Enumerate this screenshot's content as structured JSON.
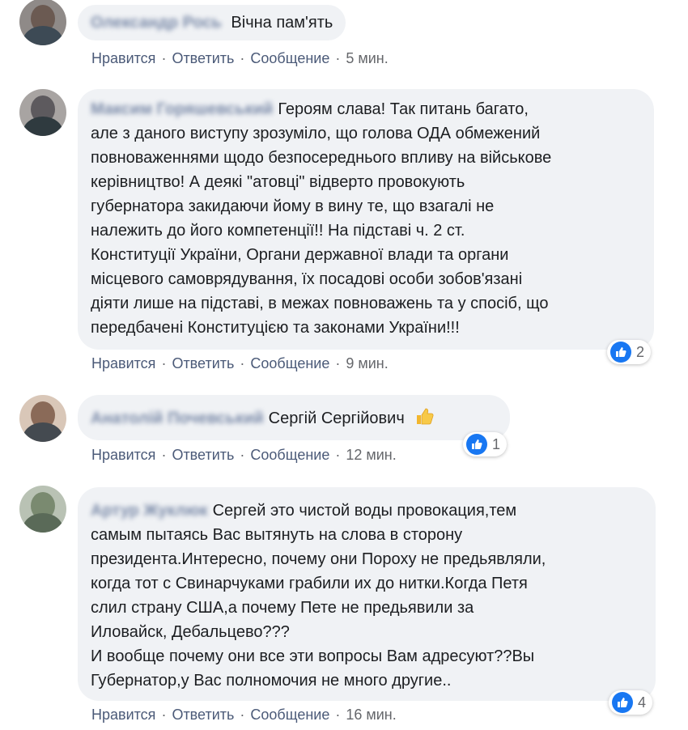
{
  "comments": [
    {
      "author": "Олександр Рось",
      "text": "Вічна пам'ять",
      "actions": {
        "like": "Нравится",
        "reply": "Ответить",
        "message": "Сообщение",
        "time": "5 мин."
      },
      "avatar_colors": [
        "#6b5a52",
        "#3d4a55"
      ]
    },
    {
      "author": "Максим Горяшевський",
      "text": "Героям слава! Так питань багато,\nале з даного виступу зрозуміло, що голова ОДА обмежений\nповноваженнями щодо безпосереднього впливу на військове\nкерівництво! А деякі \"атовці\" відверто провокують\nгубернатора закидаючи йому в вину те, що взагалі не\nналежить до його компетенції!! На підставі ч. 2 ст.\nКонституції України, Органи державної влади та органи\nмісцевого самоврядування, їх посадові особи зобов'язані\nдіяти лише на підставі, в межах повноважень та у спосіб, що\nпередбачені Конституцією та законами України!!!",
      "actions": {
        "like": "Нравится",
        "reply": "Ответить",
        "message": "Сообщение",
        "time": "9 мин."
      },
      "reaction_count": "2",
      "avatar_colors": [
        "#5d5a5e",
        "#2f3a3f"
      ]
    },
    {
      "author": "Анатолій Почевський",
      "text": "Сергій Сергійович",
      "emoji": "thumbs-up-emoji",
      "actions": {
        "like": "Нравится",
        "reply": "Ответить",
        "message": "Сообщение",
        "time": "12 мин."
      },
      "reaction_count": "1",
      "avatar_colors": [
        "#8a6a58",
        "#444a50"
      ]
    },
    {
      "author": "Артур Жуклюк",
      "text": "Сергей это чистой воды провокация,тем\nсамым пытаясь Вас вытянуть на слова в сторону\nпрезидента.Интересно, почему они Пороху не предьявляли,\nкогда тот с Свинарчуками грабили их до нитки.Когда Петя\nслил страну США,а почему Пете не предьявили за\nИловайск, Дебальцево???\nИ вообще почему они все эти вопросы Вам адресуют??Вы\nГубернатор,у Вас полномочия не много другие..",
      "actions": {
        "like": "Нравится",
        "reply": "Ответить",
        "message": "Сообщение",
        "time": "16 мин."
      },
      "reaction_count": "4",
      "avatar_colors": [
        "#7a8a70",
        "#5a6a58"
      ]
    }
  ],
  "colors": {
    "like_blue": "#1877f2",
    "bubble": "#f0f2f5",
    "action_link": "#4b5a78"
  },
  "icons": {
    "like": "thumbs-up-icon"
  }
}
